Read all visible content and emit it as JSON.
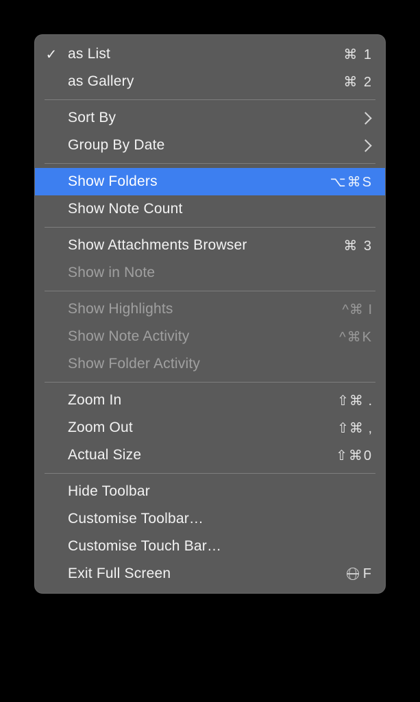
{
  "menu": {
    "groups": [
      [
        {
          "id": "as-list",
          "label": "as List",
          "shortcut": "⌘ 1",
          "checked": true,
          "highlight": false,
          "disabled": false,
          "submenu": false
        },
        {
          "id": "as-gallery",
          "label": "as Gallery",
          "shortcut": "⌘ 2",
          "checked": false,
          "highlight": false,
          "disabled": false,
          "submenu": false
        }
      ],
      [
        {
          "id": "sort-by",
          "label": "Sort By",
          "shortcut": "",
          "checked": false,
          "highlight": false,
          "disabled": false,
          "submenu": true
        },
        {
          "id": "group-by-date",
          "label": "Group By Date",
          "shortcut": "",
          "checked": false,
          "highlight": false,
          "disabled": false,
          "submenu": true
        }
      ],
      [
        {
          "id": "show-folders",
          "label": "Show Folders",
          "shortcut": "⌥⌘S",
          "checked": false,
          "highlight": true,
          "disabled": false,
          "submenu": false
        },
        {
          "id": "show-note-count",
          "label": "Show Note Count",
          "shortcut": "",
          "checked": false,
          "highlight": false,
          "disabled": false,
          "submenu": false
        }
      ],
      [
        {
          "id": "show-attachments-browser",
          "label": "Show Attachments Browser",
          "shortcut": "⌘ 3",
          "checked": false,
          "highlight": false,
          "disabled": false,
          "submenu": false
        },
        {
          "id": "show-in-note",
          "label": "Show in Note",
          "shortcut": "",
          "checked": false,
          "highlight": false,
          "disabled": true,
          "submenu": false
        }
      ],
      [
        {
          "id": "show-highlights",
          "label": "Show Highlights",
          "shortcut": "^⌘ I",
          "checked": false,
          "highlight": false,
          "disabled": true,
          "submenu": false
        },
        {
          "id": "show-note-activity",
          "label": "Show Note Activity",
          "shortcut": "^⌘K",
          "checked": false,
          "highlight": false,
          "disabled": true,
          "submenu": false
        },
        {
          "id": "show-folder-activity",
          "label": "Show Folder Activity",
          "shortcut": "",
          "checked": false,
          "highlight": false,
          "disabled": true,
          "submenu": false
        }
      ],
      [
        {
          "id": "zoom-in",
          "label": "Zoom In",
          "shortcut": "⇧⌘ .",
          "checked": false,
          "highlight": false,
          "disabled": false,
          "submenu": false
        },
        {
          "id": "zoom-out",
          "label": "Zoom Out",
          "shortcut": "⇧⌘ ,",
          "checked": false,
          "highlight": false,
          "disabled": false,
          "submenu": false
        },
        {
          "id": "actual-size",
          "label": "Actual Size",
          "shortcut": "⇧⌘0",
          "checked": false,
          "highlight": false,
          "disabled": false,
          "submenu": false
        }
      ],
      [
        {
          "id": "hide-toolbar",
          "label": "Hide Toolbar",
          "shortcut": "",
          "checked": false,
          "highlight": false,
          "disabled": false,
          "submenu": false
        },
        {
          "id": "customise-toolbar",
          "label": "Customise Toolbar…",
          "shortcut": "",
          "checked": false,
          "highlight": false,
          "disabled": false,
          "submenu": false
        },
        {
          "id": "customise-touch-bar",
          "label": "Customise Touch Bar…",
          "shortcut": "",
          "checked": false,
          "highlight": false,
          "disabled": false,
          "submenu": false
        },
        {
          "id": "exit-full-screen",
          "label": "Exit Full Screen",
          "shortcut": "F",
          "checked": false,
          "highlight": false,
          "disabled": false,
          "submenu": false,
          "globe": true
        }
      ]
    ]
  }
}
